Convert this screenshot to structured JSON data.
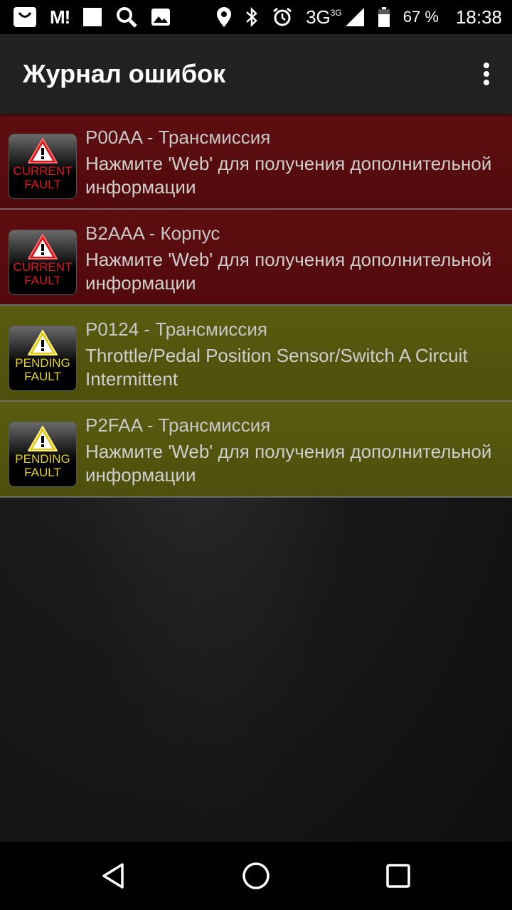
{
  "status_bar": {
    "mail_label": "M!",
    "network": "3G",
    "network_sup": "3G",
    "battery": "67 %",
    "time": "18:38"
  },
  "app_bar": {
    "title": "Журнал ошибок"
  },
  "faults": [
    {
      "type": "current",
      "badge_line1": "CURRENT",
      "badge_line2": "FAULT",
      "title": "P00AA - Трансмиссия",
      "description": "Нажмите 'Web' для получения дополнительной информации"
    },
    {
      "type": "current",
      "badge_line1": "CURRENT",
      "badge_line2": "FAULT",
      "title": "B2AAA - Корпус",
      "description": "Нажмите 'Web' для получения дополнительной информации"
    },
    {
      "type": "pending",
      "badge_line1": "PENDING",
      "badge_line2": "FAULT",
      "title": "P0124 - Трансмиссия",
      "description": "Throttle/Pedal Position Sensor/Switch A Circuit Intermittent"
    },
    {
      "type": "pending",
      "badge_line1": "PENDING",
      "badge_line2": "FAULT",
      "title": "P2FAA - Трансмиссия",
      "description": "Нажмите 'Web' для получения дополнительной информации"
    }
  ],
  "colors": {
    "current_bg": "#5e0d0f",
    "pending_bg": "#5a5c10",
    "current_badge_text": "#e0161b",
    "pending_badge_text": "#e5d21a"
  }
}
